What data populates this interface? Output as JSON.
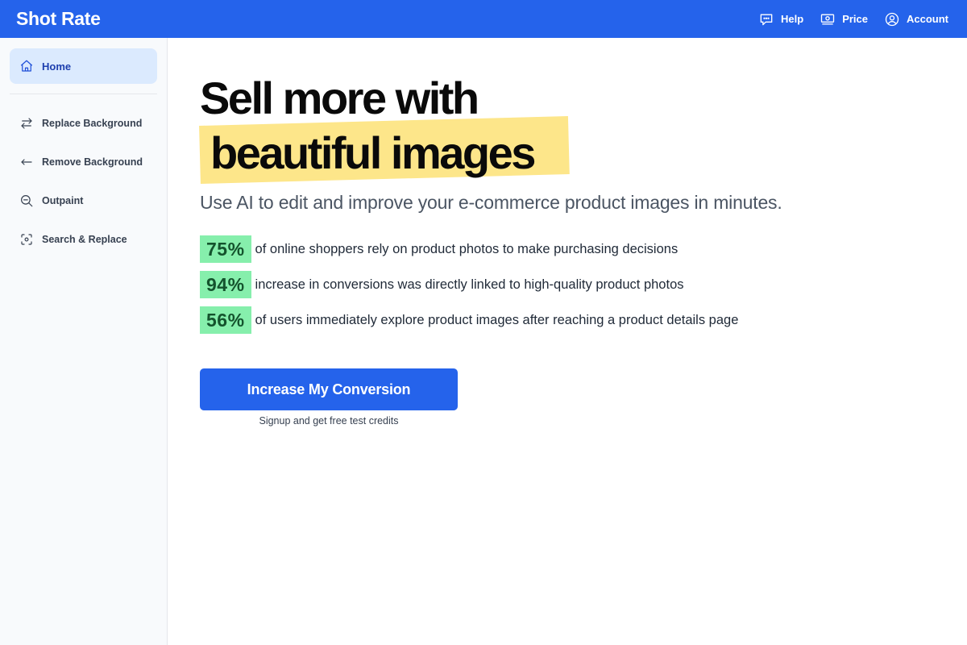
{
  "app": {
    "title": "Shot Rate"
  },
  "topnav": {
    "items": [
      {
        "label": "Help",
        "icon": "chat-bubble-icon"
      },
      {
        "label": "Price",
        "icon": "banknote-icon"
      },
      {
        "label": "Account",
        "icon": "user-circle-icon"
      }
    ]
  },
  "sidebar": {
    "active": {
      "label": "Home",
      "icon": "home-icon"
    },
    "items": [
      {
        "label": "Replace Background",
        "icon": "arrows-swap-icon"
      },
      {
        "label": "Remove Background",
        "icon": "arrow-left-icon"
      },
      {
        "label": "Outpaint",
        "icon": "zoom-out-icon"
      },
      {
        "label": "Search & Replace",
        "icon": "viewfinder-icon"
      }
    ]
  },
  "hero": {
    "headline_line1": "Sell more with",
    "headline_line2": "beautiful images",
    "subtitle": "Use AI to edit and improve your e-commerce product images in minutes."
  },
  "stats": [
    {
      "value": "75%",
      "text": "of online shoppers rely on product photos to make purchasing decisions"
    },
    {
      "value": "94%",
      "text": "increase in conversions was directly linked to high-quality product photos"
    },
    {
      "value": "56%",
      "text": "of users immediately explore product images after reaching a product details page"
    }
  ],
  "cta": {
    "label": "Increase My Conversion",
    "sublabel": "Signup and get free test credits"
  },
  "colors": {
    "brand": "#2563eb",
    "highlight_yellow": "#fde68a",
    "stat_green": "#86efac",
    "active_nav_bg": "#dbeafe"
  }
}
